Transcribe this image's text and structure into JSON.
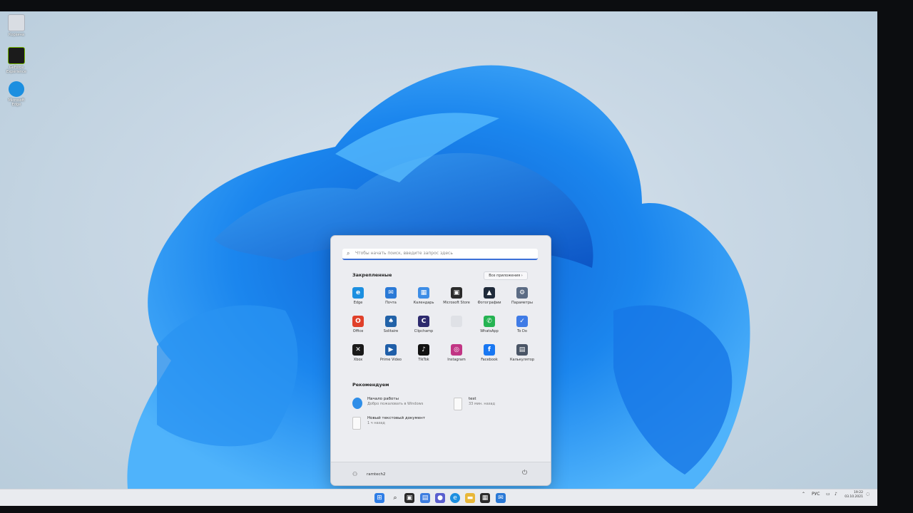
{
  "desktop": {
    "icons": [
      {
        "label": "Корзина"
      },
      {
        "label": "GeForce Experience"
      },
      {
        "label": "Microsoft Edge"
      }
    ]
  },
  "start_menu": {
    "search": {
      "placeholder": "Чтобы начать поиск, введите запрос здесь"
    },
    "pinned": {
      "title": "Закрепленные",
      "all_apps_label": "Все приложения  ›",
      "apps": [
        {
          "label": "Edge",
          "icon": "edge-icon",
          "color": "#1c8fe0"
        },
        {
          "label": "Почта",
          "icon": "mail-icon",
          "color": "#2a79d6"
        },
        {
          "label": "Календарь",
          "icon": "calendar-icon",
          "color": "#3d8de6"
        },
        {
          "label": "Microsoft Store",
          "icon": "store-icon",
          "color": "#2b2b2b"
        },
        {
          "label": "Фотографии",
          "icon": "photos-icon",
          "color": "#1f2a3a"
        },
        {
          "label": "Параметры",
          "icon": "settings-gear-icon",
          "color": "#5b6b84"
        },
        {
          "label": "Office",
          "icon": "office-icon",
          "color": "#e0402a"
        },
        {
          "label": "Solitaire",
          "icon": "solitaire-icon",
          "color": "#2262a8"
        },
        {
          "label": "Clipchamp",
          "icon": "clipchamp-icon",
          "color": "#2d2a6e"
        },
        {
          "label": "",
          "icon": "blank-app-icon",
          "color": "#dfe1e6"
        },
        {
          "label": "WhatsApp",
          "icon": "whatsapp-icon",
          "color": "#25b352"
        },
        {
          "label": "To Do",
          "icon": "todo-icon",
          "color": "#3f7be6"
        },
        {
          "label": "Xbox",
          "icon": "xbox-icon",
          "color": "#1a1a1a"
        },
        {
          "label": "Prime Video",
          "icon": "prime-video-icon",
          "color": "#1f5ea8"
        },
        {
          "label": "TikTok",
          "icon": "tiktok-icon",
          "color": "#111111"
        },
        {
          "label": "Instagram",
          "icon": "instagram-icon",
          "color": "#c13584"
        },
        {
          "label": "Facebook",
          "icon": "facebook-icon",
          "color": "#1877f2"
        },
        {
          "label": "Калькулятор",
          "icon": "calculator-icon",
          "color": "#4a5566"
        }
      ]
    },
    "recommended": {
      "title": "Рекомендуем",
      "items": [
        {
          "title": "Начало работы",
          "subtitle": "Добро пожаловать в Windows",
          "icon": "get-started-icon"
        },
        {
          "title": "test",
          "subtitle": "33 мин. назад",
          "icon": "text-file-icon"
        },
        {
          "title": "Новый текстовый документ",
          "subtitle": "1 ч назад",
          "icon": "text-file-icon"
        }
      ]
    },
    "user": {
      "name": "ramtech2"
    }
  },
  "taskbar": {
    "tray": {
      "language": "РУС",
      "time": "19:22",
      "date": "03.10.2021"
    }
  },
  "colors": {
    "accent": "#3a6fd8",
    "wallpaper_blue": "#1e7fe8"
  }
}
